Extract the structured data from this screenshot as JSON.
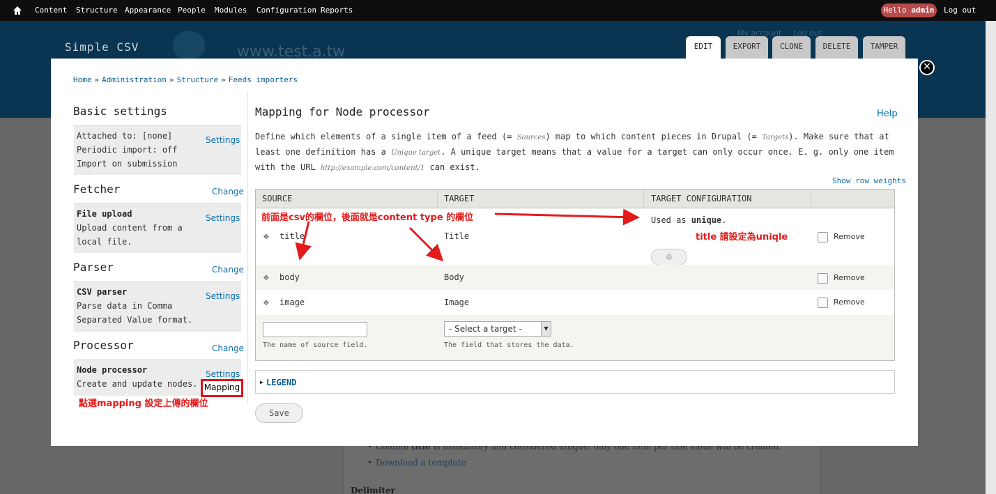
{
  "toolbar": {
    "menu": [
      "Content",
      "Structure",
      "Appearance",
      "People",
      "Modules",
      "Configuration",
      "Reports"
    ],
    "hello_prefix": "Hello ",
    "hello_user": "admin",
    "logout": "Log out"
  },
  "site": {
    "name": "Simple CSV",
    "url": "www.test.a.tw",
    "my_account": "My account",
    "log_out": "Log out"
  },
  "tabs": [
    "EDIT",
    "EXPORT",
    "CLONE",
    "DELETE",
    "TAMPER"
  ],
  "breadcrumb": [
    "Home",
    "Administration",
    "Structure",
    "Feeds importers"
  ],
  "sidebar": {
    "basic": {
      "title": "Basic settings",
      "lines": [
        "Attached to: [none]",
        "Periodic import: off",
        "Import on submission"
      ],
      "settings": "Settings"
    },
    "fetcher": {
      "title": "Fetcher",
      "change": "Change",
      "name": "File upload",
      "desc1": "Upload content from a",
      "desc2": "local file.",
      "settings": "Settings"
    },
    "parser": {
      "title": "Parser",
      "change": "Change",
      "name": "CSV parser",
      "desc1": "Parse data in Comma",
      "desc2": "Separated Value format.",
      "settings": "Settings"
    },
    "processor": {
      "title": "Processor",
      "change": "Change",
      "name": "Node processor",
      "desc1": "Create and update nodes.",
      "settings": "Settings",
      "mapping": "Mapping"
    }
  },
  "main": {
    "title": "Mapping for Node processor",
    "help": "Help",
    "desc": {
      "p1": "Define which elements of a single item of a feed (= ",
      "sources": "Sources",
      "p2": ") map to which content pieces in Drupal (= ",
      "targets": "Targets",
      "p3": "). Make sure that at least one definition has a ",
      "unique_target": "Unique target",
      "p4": ". A unique target means that a value for a target can only occur once. E. g. only one item with the URL ",
      "url": "http://example.com/content/1",
      "p5": " can exist."
    },
    "show_row_weights": "Show row weights"
  },
  "table": {
    "headers": [
      "SOURCE",
      "TARGET",
      "TARGET CONFIGURATION"
    ],
    "rows": [
      {
        "source": "title",
        "target": "Title",
        "config_prefix": "Used as ",
        "config_bold": "unique",
        "config_suffix": ".",
        "remove": "Remove"
      },
      {
        "source": "body",
        "target": "Body",
        "remove": "Remove"
      },
      {
        "source": "image",
        "target": "Image",
        "remove": "Remove"
      }
    ],
    "new_row": {
      "source_value": "",
      "source_hint": "The name of source field.",
      "target_selected": "- Select a target -",
      "target_hint": "The field that stores the data."
    }
  },
  "legend": "LEGEND",
  "save": "Save",
  "annotations": {
    "top": "前面是csv的欄位，後面就是content type 的欄位",
    "unique": "title 請設定為uniqle",
    "mapping": "點選mapping 設定上傳的欄位"
  },
  "background": {
    "item1_prefix": "Column ",
    "item1_bold": "title",
    "item1_suffix": " is mandatory and considered unique: only one item per title value will be created.",
    "item2": "Download a template",
    "delimiter": "Delimiter"
  },
  "colors": {
    "accent_link": "#0b6fb0",
    "annotation_red": "#e51a1a",
    "header_bg": "#0a3552",
    "toolbar_bg": "#0e0e0e"
  }
}
